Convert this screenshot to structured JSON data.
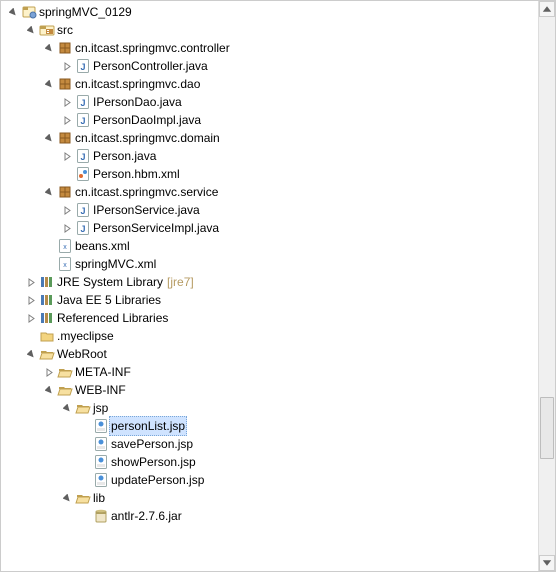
{
  "tree": [
    {
      "d": 0,
      "tw": "open",
      "ic": "project",
      "t": "springMVC_0129"
    },
    {
      "d": 1,
      "tw": "open",
      "ic": "srcfolder",
      "t": "src"
    },
    {
      "d": 2,
      "tw": "open",
      "ic": "package",
      "t": "cn.itcast.springmvc.controller"
    },
    {
      "d": 3,
      "tw": "closed",
      "ic": "java",
      "t": "PersonController.java"
    },
    {
      "d": 2,
      "tw": "open",
      "ic": "package",
      "t": "cn.itcast.springmvc.dao"
    },
    {
      "d": 3,
      "tw": "closed",
      "ic": "java",
      "t": "IPersonDao.java"
    },
    {
      "d": 3,
      "tw": "closed",
      "ic": "java",
      "t": "PersonDaoImpl.java"
    },
    {
      "d": 2,
      "tw": "open",
      "ic": "package",
      "t": "cn.itcast.springmvc.domain"
    },
    {
      "d": 3,
      "tw": "closed",
      "ic": "java",
      "t": "Person.java"
    },
    {
      "d": 3,
      "tw": "none",
      "ic": "hbm",
      "t": "Person.hbm.xml"
    },
    {
      "d": 2,
      "tw": "open",
      "ic": "package",
      "t": "cn.itcast.springmvc.service"
    },
    {
      "d": 3,
      "tw": "closed",
      "ic": "java",
      "t": "IPersonService.java"
    },
    {
      "d": 3,
      "tw": "closed",
      "ic": "java",
      "t": "PersonServiceImpl.java"
    },
    {
      "d": 2,
      "tw": "none",
      "ic": "xml",
      "t": "beans.xml"
    },
    {
      "d": 2,
      "tw": "none",
      "ic": "xml",
      "t": "springMVC.xml"
    },
    {
      "d": 1,
      "tw": "closed",
      "ic": "lib",
      "t": "JRE System Library",
      "decor": "[jre7]"
    },
    {
      "d": 1,
      "tw": "closed",
      "ic": "lib",
      "t": "Java EE 5 Libraries"
    },
    {
      "d": 1,
      "tw": "closed",
      "ic": "lib",
      "t": "Referenced Libraries"
    },
    {
      "d": 1,
      "tw": "none",
      "ic": "folder",
      "t": ".myeclipse"
    },
    {
      "d": 1,
      "tw": "open",
      "ic": "folderopen",
      "t": "WebRoot"
    },
    {
      "d": 2,
      "tw": "closed",
      "ic": "folderopen",
      "t": "META-INF"
    },
    {
      "d": 2,
      "tw": "open",
      "ic": "folderopen",
      "t": "WEB-INF"
    },
    {
      "d": 3,
      "tw": "open",
      "ic": "folderopen",
      "t": "jsp"
    },
    {
      "d": 4,
      "tw": "none",
      "ic": "jsp",
      "t": "personList.jsp",
      "sel": true
    },
    {
      "d": 4,
      "tw": "none",
      "ic": "jsp",
      "t": "savePerson.jsp"
    },
    {
      "d": 4,
      "tw": "none",
      "ic": "jsp",
      "t": "showPerson.jsp"
    },
    {
      "d": 4,
      "tw": "none",
      "ic": "jsp",
      "t": "updatePerson.jsp"
    },
    {
      "d": 3,
      "tw": "open",
      "ic": "folderopen",
      "t": "lib"
    },
    {
      "d": 4,
      "tw": "none",
      "ic": "jar",
      "t": "antlr-2.7.6.jar"
    }
  ],
  "scrollbar": {
    "thumbTop": 380,
    "thumbHeight": 60
  }
}
